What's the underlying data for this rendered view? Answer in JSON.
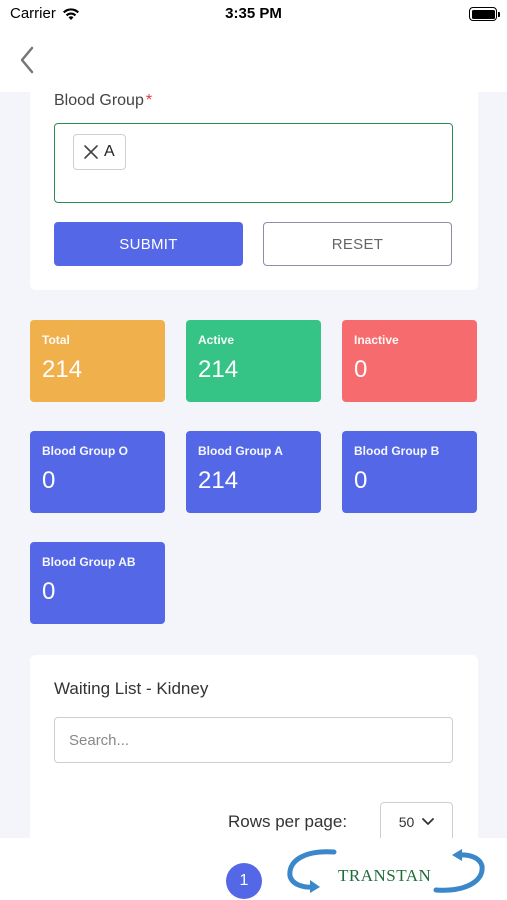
{
  "status_bar": {
    "carrier": "Carrier",
    "time": "3:35 PM"
  },
  "form": {
    "label": "Blood Group",
    "required_mark": "*",
    "selected_chip": "A",
    "submit_label": "SUBMIT",
    "reset_label": "RESET"
  },
  "stats": [
    {
      "label": "Total",
      "value": "214",
      "color": "#f0b04b"
    },
    {
      "label": "Active",
      "value": "214",
      "color": "#35c386"
    },
    {
      "label": "Inactive",
      "value": "0",
      "color": "#f66b6e"
    },
    {
      "label": "Blood Group O",
      "value": "0",
      "color": "#5468e7"
    },
    {
      "label": "Blood Group A",
      "value": "214",
      "color": "#5468e7"
    },
    {
      "label": "Blood Group B",
      "value": "0",
      "color": "#5468e7"
    },
    {
      "label": "Blood Group AB",
      "value": "0",
      "color": "#5468e7"
    }
  ],
  "waiting_list": {
    "title": "Waiting List - Kidney",
    "search_placeholder": "Search...",
    "rows_per_page_label": "Rows per page:",
    "rows_per_page_value": "50"
  },
  "pagination": {
    "current_page": "1"
  },
  "logo": {
    "text": "TRANSTAN"
  },
  "icons": {
    "back": "chevron-left-icon",
    "remove_chip": "close-icon",
    "dropdown": "chevron-down-icon"
  }
}
